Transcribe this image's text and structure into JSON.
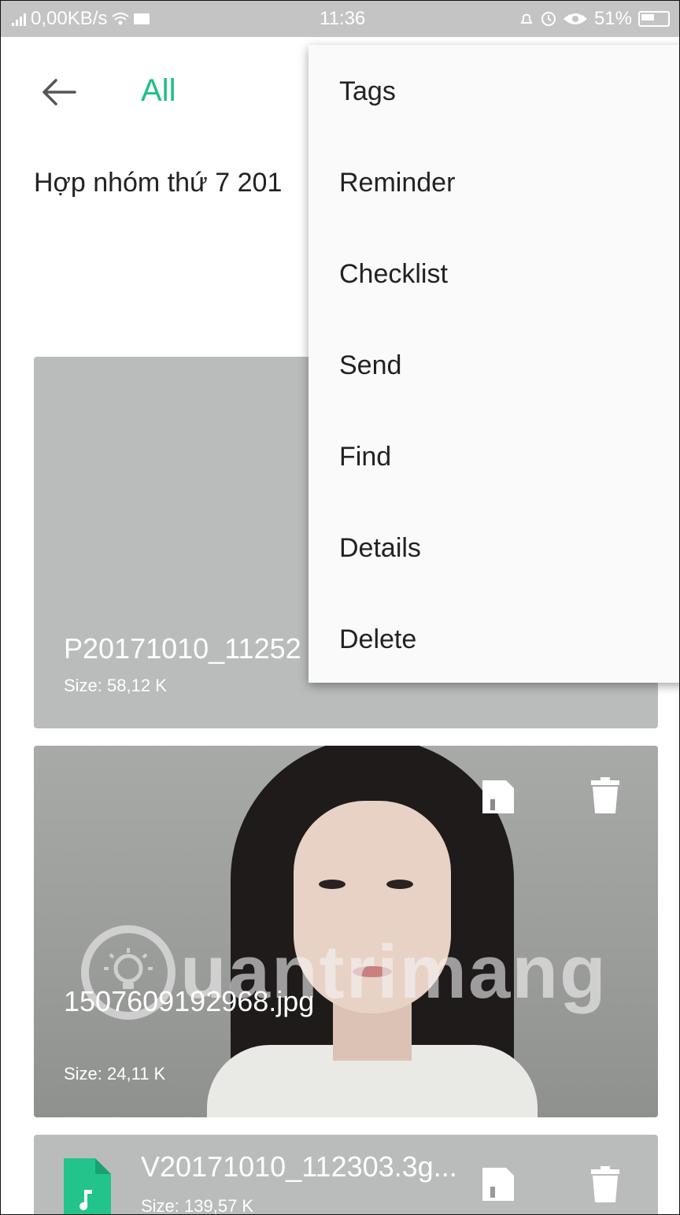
{
  "status_bar": {
    "network_speed": "0,00KB/s",
    "time": "11:36",
    "battery": "51%"
  },
  "header": {
    "back_icon": "arrow-left-icon",
    "title": "All",
    "accent_color": "#1fbf84"
  },
  "note": {
    "title": "Hợp nhóm thứ 7  201"
  },
  "attachments": [
    {
      "name": "P20171010_11252",
      "size": "Size: 58,12 K"
    },
    {
      "name": "1507609192968.jpg",
      "size": "Size: 24,11 K",
      "watermark": "uantrimang"
    },
    {
      "name": "V20171010_112303.3g...",
      "size": "Size: 139,57 K",
      "icon": "music-file-icon"
    }
  ],
  "menu": {
    "items": [
      "Tags",
      "Reminder",
      "Checklist",
      "Send",
      "Find",
      "Details",
      "Delete"
    ]
  }
}
